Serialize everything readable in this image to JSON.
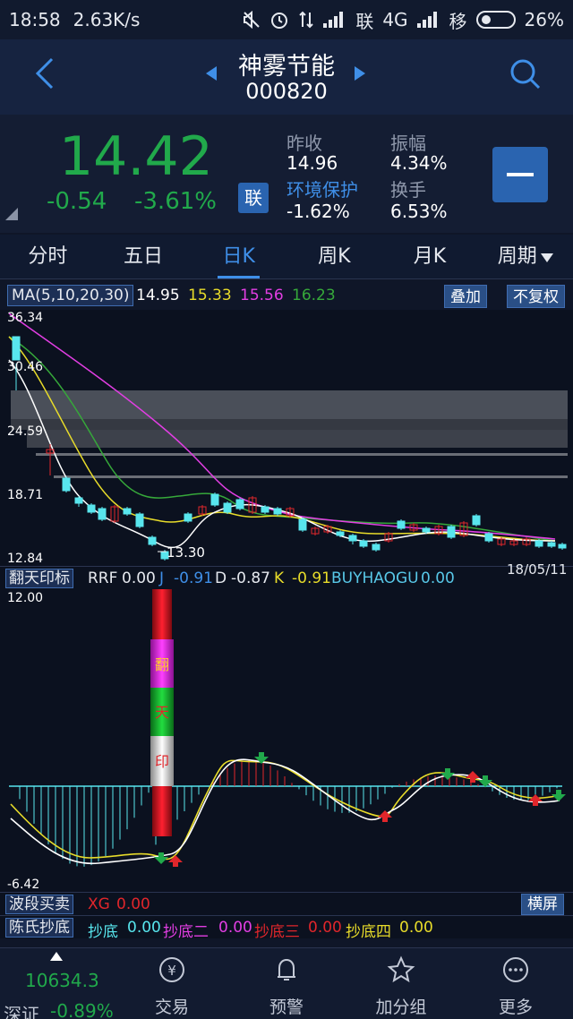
{
  "statusbar": {
    "time": "18:58",
    "netspeed": "2.63K/s",
    "carrier1": "联",
    "net": "4G",
    "carrier2": "移",
    "battery": "26%"
  },
  "header": {
    "name": "神雾节能",
    "code": "000820"
  },
  "quote": {
    "price": "14.42",
    "change": "-0.54",
    "change_pct": "-3.61%",
    "lian_badge": "联",
    "prev_close_label": "昨收",
    "prev_close": "14.96",
    "sector_label": "环境保护",
    "sector_chg": "-1.62%",
    "amplitude_label": "振幅",
    "amplitude": "4.34%",
    "turnover_label": "换手",
    "turnover": "6.53%"
  },
  "tabs": [
    "分时",
    "五日",
    "日K",
    "周K",
    "月K",
    "周期"
  ],
  "ma": {
    "label": "MA(5,10,20,30)",
    "ma5": "14.95",
    "ma10": "15.33",
    "ma20": "15.56",
    "ma30": "16.23",
    "overlay_btn": "叠加",
    "adjust_btn": "不复权"
  },
  "kchart_labels": {
    "y_top": "36.34",
    "y2": "30.46",
    "y3": "24.59",
    "y4": "18.71",
    "y_bottom": "12.84",
    "low_mark": "13.30",
    "date": "18/05/11"
  },
  "indicator": {
    "label": "翻天印标",
    "rrf_label": "RRF",
    "rrf": "0.00",
    "j_label": "J",
    "j": "-0.91",
    "d_label": "D",
    "d": "-0.87",
    "k_label": "K",
    "k": "-0.91",
    "buy_label": "BUYHAOGU",
    "buy": "0.00",
    "y_top": "12.00",
    "y_bottom": "-6.42",
    "pillar": [
      "翻",
      "天",
      "印"
    ]
  },
  "band": {
    "label": "波段买卖",
    "xg_label": "XG",
    "xg": "0.00",
    "landscape_btn": "横屏"
  },
  "chen": {
    "label": "陈氏抄底",
    "c1_label": "抄底",
    "c1": "0.00",
    "c2_label": "抄底二",
    "c2": "0.00",
    "c3_label": "抄底三",
    "c3": "0.00",
    "c4_label": "抄底四",
    "c4": "0.00"
  },
  "nav": {
    "index_value": "10634.3",
    "index_name": "深证",
    "index_change": "-0.89%",
    "items": [
      "交易",
      "预警",
      "加分组",
      "更多"
    ]
  },
  "colors": {
    "up": "#e0262b",
    "down": "#21a94b",
    "cyan": "#58e6ee",
    "ma5": "#ffffff",
    "ma10": "#e8dc2a",
    "ma20": "#e23ee3",
    "ma30": "#36a83a",
    "accent": "#3f8fe8"
  }
}
